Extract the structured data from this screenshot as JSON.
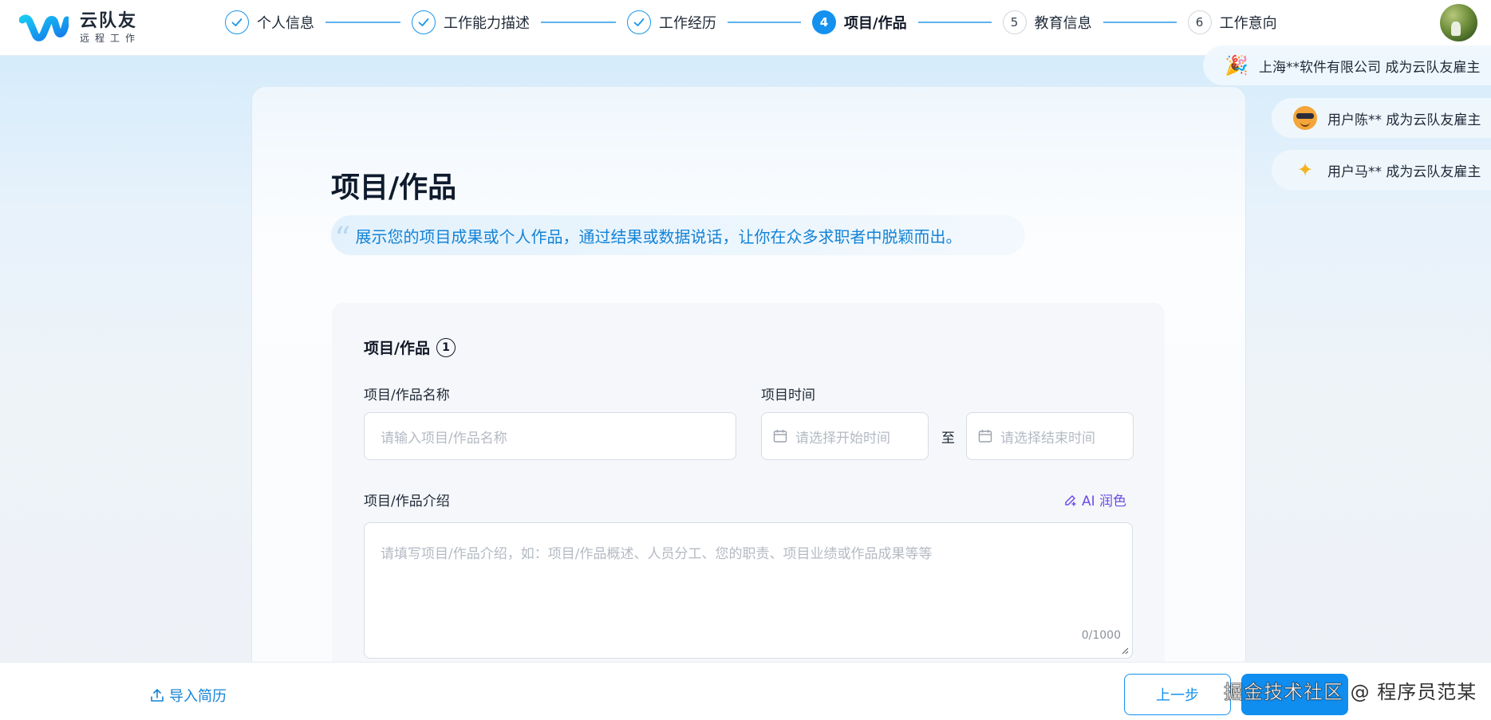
{
  "brand": {
    "name": "云队友",
    "slogan": "远程工作"
  },
  "steps": [
    {
      "num": "1",
      "label": "个人信息",
      "state": "done"
    },
    {
      "num": "2",
      "label": "工作能力描述",
      "state": "done"
    },
    {
      "num": "3",
      "label": "工作经历",
      "state": "done"
    },
    {
      "num": "4",
      "label": "项目/作品",
      "state": "active"
    },
    {
      "num": "5",
      "label": "教育信息",
      "state": "todo"
    },
    {
      "num": "6",
      "label": "工作意向",
      "state": "todo"
    }
  ],
  "notices": [
    {
      "text": "上海**软件有限公司 成为云队友雇主",
      "icon": "party-popper-icon"
    },
    {
      "text": "用户陈** 成为云队友雇主",
      "icon": "sunglasses-face-icon"
    },
    {
      "text": "用户马** 成为云队友雇主",
      "icon": "sparkles-icon"
    }
  ],
  "page": {
    "title": "项目/作品",
    "subtitle": "展示您的项目成果或个人作品，通过结果或数据说话，让你在众多求职者中脱颖而出。"
  },
  "form": {
    "section_title": "项目/作品",
    "section_num": "1",
    "name_label": "项目/作品名称",
    "name_placeholder": "请输入项目/作品名称",
    "time_label": "项目时间",
    "start_placeholder": "请选择开始时间",
    "range_sep": "至",
    "end_placeholder": "请选择结束时间",
    "intro_label": "项目/作品介绍",
    "ai_label": "AI 润色",
    "intro_placeholder": "请填写项目/作品介绍，如：项目/作品概述、人员分工、您的职责、项目业绩或作品成果等等",
    "counter": "0/1000"
  },
  "footer": {
    "import_label": "导入简历",
    "prev_label": "上一步",
    "watermark": "掘金技术社区",
    "watermark_author": "@ 程序员范某"
  },
  "colors": {
    "accent": "#1491ef",
    "ai": "#6d4ee6",
    "subtitle": "#1383d6"
  }
}
